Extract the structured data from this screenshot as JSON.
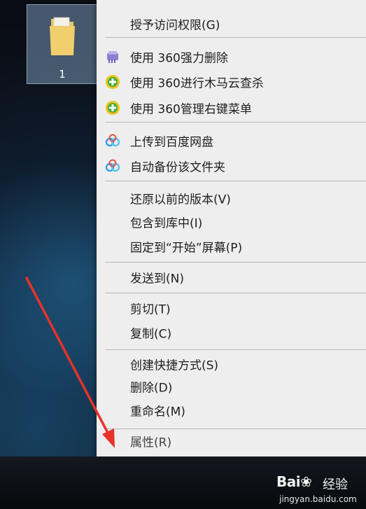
{
  "desktop": {
    "folder": {
      "name": "1",
      "icon": "folder-icon"
    }
  },
  "context_menu": {
    "items": [
      {
        "label": "授予访问权限(G)",
        "icon": ""
      },
      {
        "label": "使用 360强力删除",
        "icon": "360-shred-icon"
      },
      {
        "label": "使用 360进行木马云查杀",
        "icon": "360-scan-icon"
      },
      {
        "label": "使用 360管理右键菜单",
        "icon": "360-menu-icon"
      },
      {
        "label": "上传到百度网盘",
        "icon": "baidu-netdisk-icon"
      },
      {
        "label": "自动备份该文件夹",
        "icon": "baidu-netdisk-icon"
      },
      {
        "label": "还原以前的版本(V)",
        "icon": ""
      },
      {
        "label": "包含到库中(I)",
        "icon": ""
      },
      {
        "label": "固定到“开始”屏幕(P)",
        "icon": ""
      },
      {
        "label": "发送到(N)",
        "icon": ""
      },
      {
        "label": "剪切(T)",
        "icon": ""
      },
      {
        "label": "复制(C)",
        "icon": ""
      },
      {
        "label": "创建快捷方式(S)",
        "icon": ""
      },
      {
        "label": "删除(D)",
        "icon": ""
      },
      {
        "label": "重命名(M)",
        "icon": ""
      },
      {
        "label": "属性(R)",
        "icon": ""
      }
    ]
  },
  "annotation": {
    "arrow_color": "#e8322a",
    "target": "属性(R)"
  },
  "watermark": {
    "brand": "Bai",
    "brand_suffix": "经验",
    "url": "jingyan.baidu.com"
  },
  "colors": {
    "menu_bg": "#eeeeee",
    "separator": "#b8b8b8",
    "selection": "#9fb4c8"
  }
}
